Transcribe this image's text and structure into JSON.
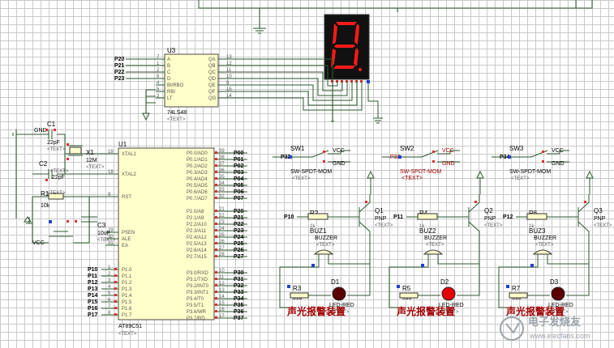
{
  "u3": {
    "ref": "U3",
    "part": "74LS48",
    "text": "<TEXT>",
    "inputs": [
      {
        "net": "P20",
        "pin": "7",
        "name": "A"
      },
      {
        "net": "P21",
        "pin": "1",
        "name": "B"
      },
      {
        "net": "P22",
        "pin": "2",
        "name": "C"
      },
      {
        "net": "P23",
        "pin": "6",
        "name": "D"
      },
      {
        "net": "",
        "pin": "4",
        "name": "BI/RBO"
      },
      {
        "net": "",
        "pin": "5",
        "name": "RBI"
      },
      {
        "net": "",
        "pin": "3",
        "name": "LT"
      }
    ],
    "outputs": [
      {
        "pin": "13",
        "name": "QA"
      },
      {
        "pin": "12",
        "name": "QB"
      },
      {
        "pin": "11",
        "name": "QC"
      },
      {
        "pin": "10",
        "name": "QD"
      },
      {
        "pin": "9",
        "name": "QE"
      },
      {
        "pin": "15",
        "name": "QF"
      },
      {
        "pin": "14",
        "name": "QG"
      }
    ]
  },
  "display": {
    "digit": "8",
    "color": "#ff1a1a",
    "bg": "#111111"
  },
  "u1": {
    "ref": "U1",
    "part": "AT89C51",
    "text": "<TEXT>",
    "left_pins": [
      {
        "pin": "19",
        "name": "XTAL1"
      },
      {
        "pin": "18",
        "name": "XTAL2"
      },
      {
        "pin": "9",
        "name": "RST"
      },
      {
        "pin": "29",
        "name": "PSEN"
      },
      {
        "pin": "30",
        "name": "ALE"
      },
      {
        "pin": "31",
        "name": "EA"
      }
    ],
    "p1_pins": [
      {
        "net": "P10",
        "pin": "1",
        "name": "P1.0"
      },
      {
        "net": "P11",
        "pin": "2",
        "name": "P1.1"
      },
      {
        "net": "P12",
        "pin": "3",
        "name": "P1.2"
      },
      {
        "net": "P13",
        "pin": "4",
        "name": "P1.3"
      },
      {
        "net": "P14",
        "pin": "5",
        "name": "P1.4"
      },
      {
        "net": "P15",
        "pin": "6",
        "name": "P1.5"
      },
      {
        "net": "P16",
        "pin": "7",
        "name": "P1.6"
      },
      {
        "net": "P17",
        "pin": "8",
        "name": "P1.7"
      }
    ],
    "p0_pins": [
      {
        "name": "P0.0/AD0",
        "pin": "39",
        "net": "P00"
      },
      {
        "name": "P0.1/AD1",
        "pin": "38",
        "net": "P01"
      },
      {
        "name": "P0.2/AD2",
        "pin": "37",
        "net": "P02"
      },
      {
        "name": "P0.3/AD3",
        "pin": "36",
        "net": "P03"
      },
      {
        "name": "P0.4/AD4",
        "pin": "35",
        "net": "P04"
      },
      {
        "name": "P0.5/AD5",
        "pin": "34",
        "net": "P05"
      },
      {
        "name": "P0.6/AD6",
        "pin": "33",
        "net": "P06"
      },
      {
        "name": "P0.7/AD7",
        "pin": "32",
        "net": "P07"
      }
    ],
    "p2_pins": [
      {
        "name": "P2.0/A8",
        "pin": "21",
        "net": "P20"
      },
      {
        "name": "P2.1/A9",
        "pin": "22",
        "net": "P21"
      },
      {
        "name": "P2.2/A10",
        "pin": "23",
        "net": "P22"
      },
      {
        "name": "P2.3/A11",
        "pin": "24",
        "net": "P23"
      },
      {
        "name": "P2.4/A12",
        "pin": "25",
        "net": "P24"
      },
      {
        "name": "P2.5/A13",
        "pin": "26",
        "net": "P25"
      },
      {
        "name": "P2.6/A14",
        "pin": "27",
        "net": "P26"
      },
      {
        "name": "P2.7/A15",
        "pin": "28",
        "net": "P27"
      }
    ],
    "p3_pins": [
      {
        "name": "P3.0/RXD",
        "pin": "10",
        "net": "P30"
      },
      {
        "name": "P3.1/TXD",
        "pin": "11",
        "net": "P31"
      },
      {
        "name": "P3.2/INT0",
        "pin": "12",
        "net": "P32"
      },
      {
        "name": "P3.3/INT1",
        "pin": "13",
        "net": "P33"
      },
      {
        "name": "P3.4/T0",
        "pin": "14",
        "net": "P34"
      },
      {
        "name": "P3.5/T1",
        "pin": "15",
        "net": "P35"
      },
      {
        "name": "P3.6/WR",
        "pin": "16",
        "net": "P36"
      },
      {
        "name": "P3.7/RD",
        "pin": "17",
        "net": "P37"
      }
    ]
  },
  "clock": {
    "c1": {
      "ref": "C1",
      "value": "22pF",
      "text": "<TEXT>"
    },
    "c2": {
      "ref": "C2",
      "value": "22pF",
      "text": "<TEXT>"
    },
    "x1": {
      "ref": "X1",
      "value": "12M",
      "text": "<TEXT>"
    },
    "gnd": "GND"
  },
  "reset": {
    "r1": {
      "ref": "R1",
      "value": "10k",
      "text": "<TEXT>"
    },
    "c3": {
      "ref": "C3",
      "value": "10uF",
      "text": "<TEXT>"
    },
    "vcc": "VCC"
  },
  "alarms": [
    {
      "sw": "SW1",
      "sw_net": "P32",
      "sw_type": "SW-SPDT-MOM",
      "r_base": "R2",
      "base_net": "P10",
      "q": "Q1",
      "buz": "BUZ1",
      "r_led": "R3",
      "r_led_val": "510",
      "led": "D1",
      "label": "声光报警装置"
    },
    {
      "sw": "SW2",
      "sw_net": "P33",
      "sw_type": "SW-SPDT-MOM",
      "r_base": "R4",
      "base_net": "P11",
      "q": "Q2",
      "buz": "BUZ2",
      "r_led": "R5",
      "r_led_val": "510",
      "led": "D2",
      "label": "声光报警装置"
    },
    {
      "sw": "SW3",
      "sw_net": "P34",
      "sw_type": "SW-SPDT-MOM",
      "r_base": "R6",
      "base_net": "P12",
      "q": "Q3",
      "buz": "BUZ3",
      "r_led": "R7",
      "r_led_val": "510",
      "led": "D3",
      "label": "声光报警装置"
    }
  ],
  "common": {
    "vcc": "VCC",
    "gnd": "GND",
    "pnp": "PNP",
    "r1k": "1k",
    "buzzer": "BUZZER",
    "led_type": "LED-RED",
    "text": "<TEXT>"
  },
  "watermark": {
    "text": "电子发烧友",
    "url": "www.elecfans.com"
  }
}
